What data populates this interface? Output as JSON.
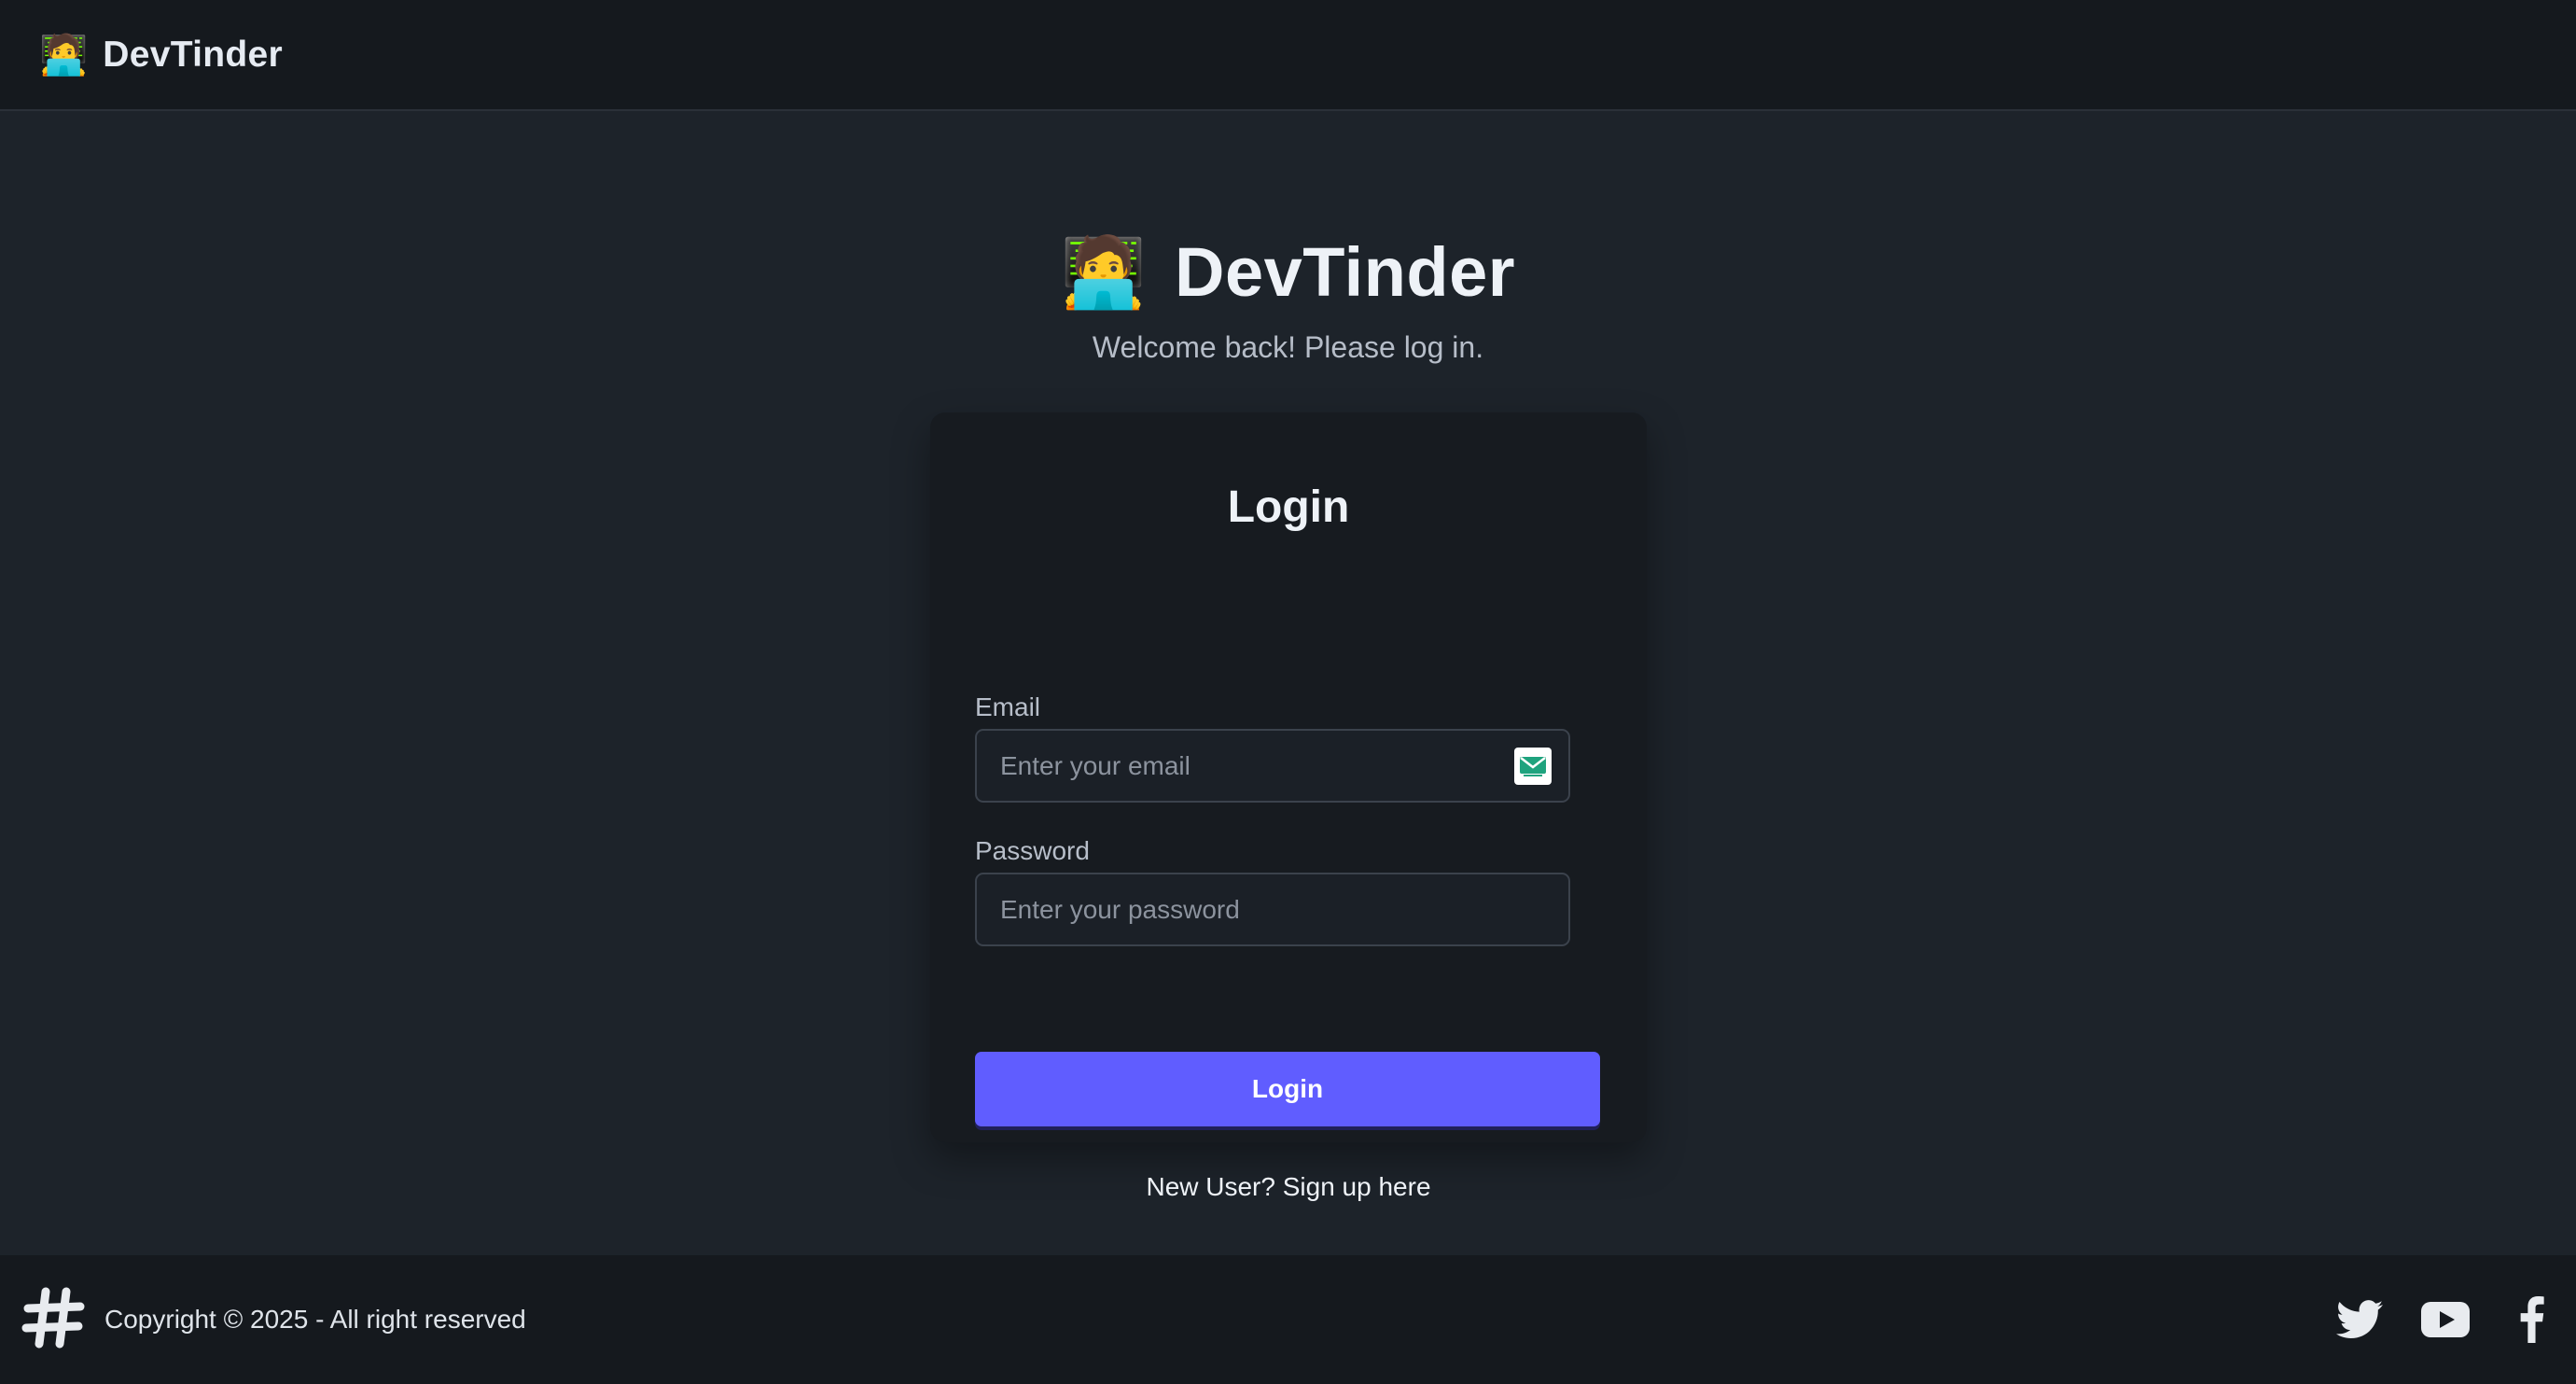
{
  "navbar": {
    "emoji": "🧑‍💻",
    "brand": "DevTinder"
  },
  "hero": {
    "emoji": "🧑‍💻",
    "title": "DevTinder",
    "subtitle": "Welcome back! Please log in."
  },
  "form": {
    "title": "Login",
    "email_label": "Email",
    "email_placeholder": "Enter your email",
    "email_value": "",
    "password_label": "Password",
    "password_placeholder": "Enter your password",
    "password_value": "",
    "submit_label": "Login",
    "signup_text": "New User? Sign up here"
  },
  "footer": {
    "copyright": "Copyright © 2025 - All right reserved",
    "social": [
      "twitter-icon",
      "youtube-icon",
      "facebook-icon"
    ]
  },
  "colors": {
    "page_bg": "#1d232a",
    "nav_bg": "#15191e",
    "card_bg": "#171b20",
    "primary": "#605dff"
  }
}
